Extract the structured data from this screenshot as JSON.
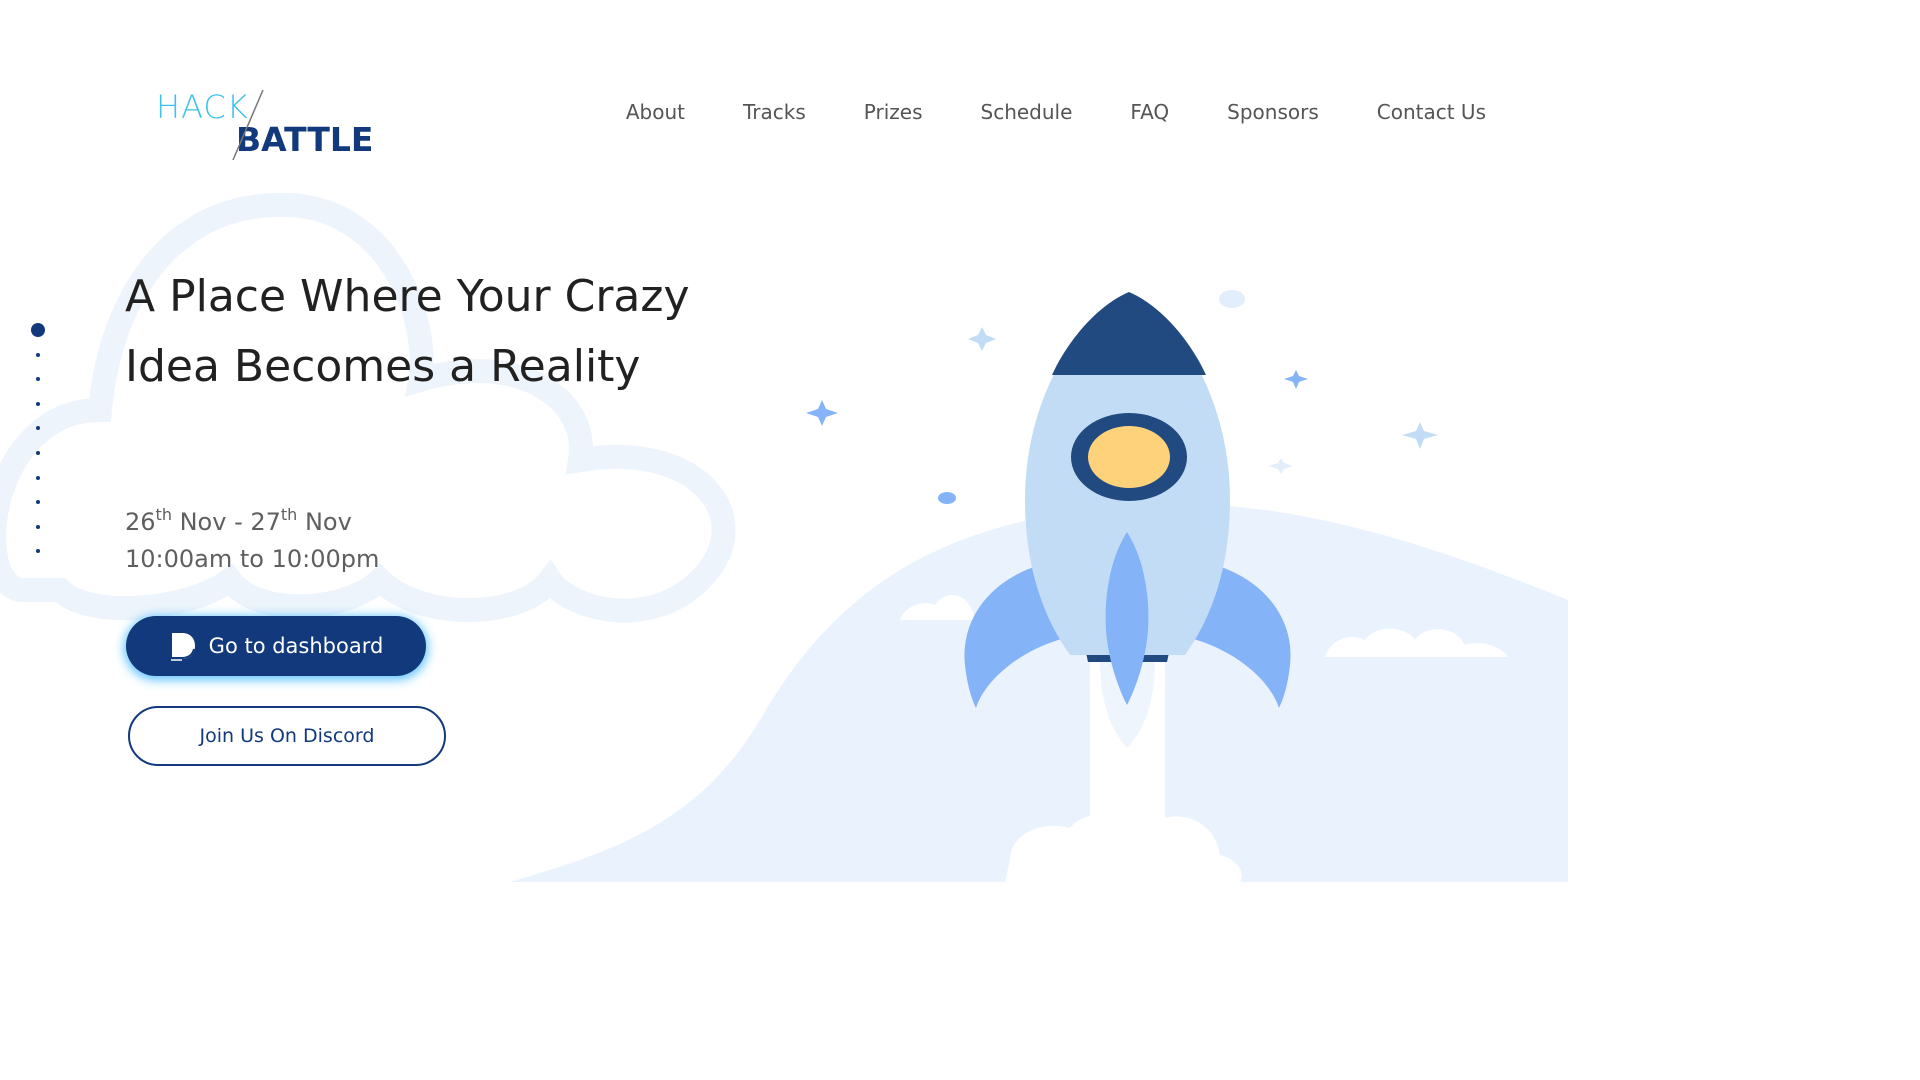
{
  "logo": {
    "hack": "HACK",
    "battle": "BATTLE"
  },
  "nav": [
    {
      "label": "About"
    },
    {
      "label": "Tracks"
    },
    {
      "label": "Prizes"
    },
    {
      "label": "Schedule"
    },
    {
      "label": "FAQ"
    },
    {
      "label": "Sponsors"
    },
    {
      "label": "Contact Us"
    }
  ],
  "hero": {
    "title": "A Place Where Your Crazy Idea Becomes a Reality",
    "date_start_day": "26",
    "date_start_sup": "th",
    "date_start_month": " Nov - ",
    "date_end_day": "27",
    "date_end_sup": "th",
    "date_end_month": " Nov",
    "time": "10:00am to 10:00pm"
  },
  "buttons": {
    "dashboard_label": "Go to dashboard",
    "discord_label": "Join Us On Discord"
  },
  "colors": {
    "brand_navy": "#12397c",
    "brand_cyan": "#3ec3ea",
    "light_blue": "#c2dcf6",
    "mid_blue": "#85b3f8",
    "rocket_window": "#fdd27a"
  },
  "icons": {
    "dashboard_icon": "dashboard-icon",
    "rocket": "rocket-illustration"
  }
}
